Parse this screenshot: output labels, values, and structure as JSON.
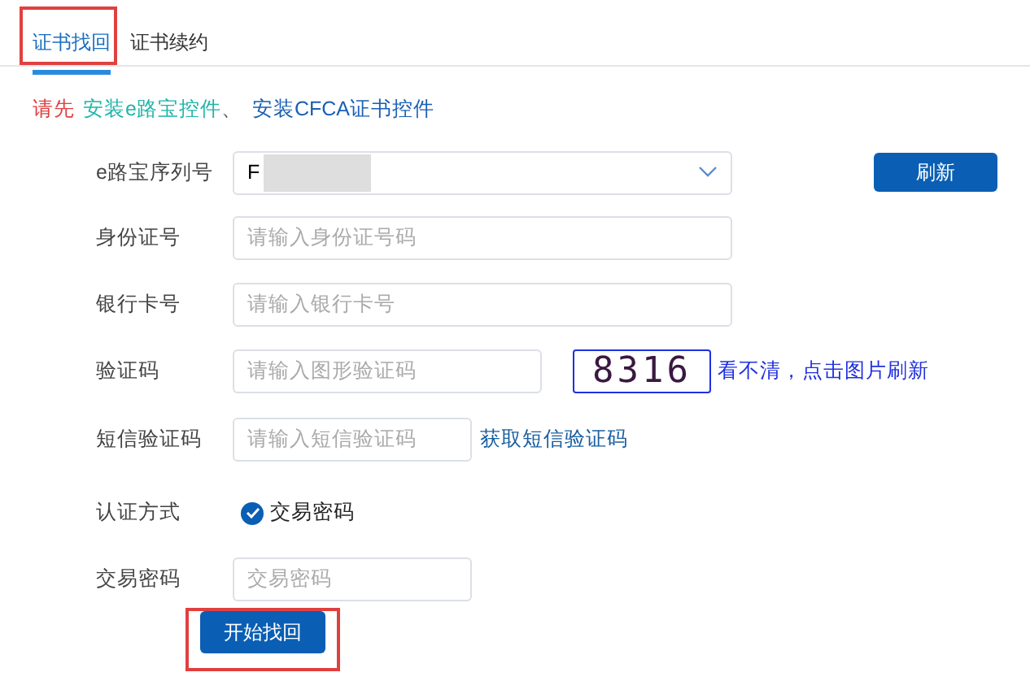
{
  "tabs": [
    {
      "label": "证书找回",
      "selected": true,
      "highlighted": true
    },
    {
      "label": "证书续约",
      "selected": false,
      "highlighted": false
    }
  ],
  "notice": {
    "prefix": "请先",
    "links": [
      {
        "label": "安装e路宝控件",
        "color": "#1fb5a8"
      },
      {
        "label": "安装CFCA证书控件",
        "color": "#1a5fb4"
      }
    ],
    "separator": "、"
  },
  "form": {
    "serial": {
      "label": "e路宝序列号",
      "value": "F",
      "masked": true,
      "button": "刷新"
    },
    "id_card": {
      "label": "身份证号",
      "placeholder": "请输入身份证号码"
    },
    "bank_card": {
      "label": "银行卡号",
      "placeholder": "请输入银行卡号"
    },
    "captcha": {
      "label": "验证码",
      "placeholder": "请输入图形验证码",
      "image_text": "8316",
      "refresh_link": "看不清，点击图片刷新"
    },
    "sms": {
      "label": "短信验证码",
      "placeholder": "请输入短信验证码",
      "link": "获取短信验证码"
    },
    "auth": {
      "label": "认证方式",
      "option": "交易密码",
      "checked": true
    },
    "password": {
      "label": "交易密码",
      "placeholder": "交易密码"
    },
    "submit": {
      "label": "开始找回",
      "highlighted": true
    }
  }
}
